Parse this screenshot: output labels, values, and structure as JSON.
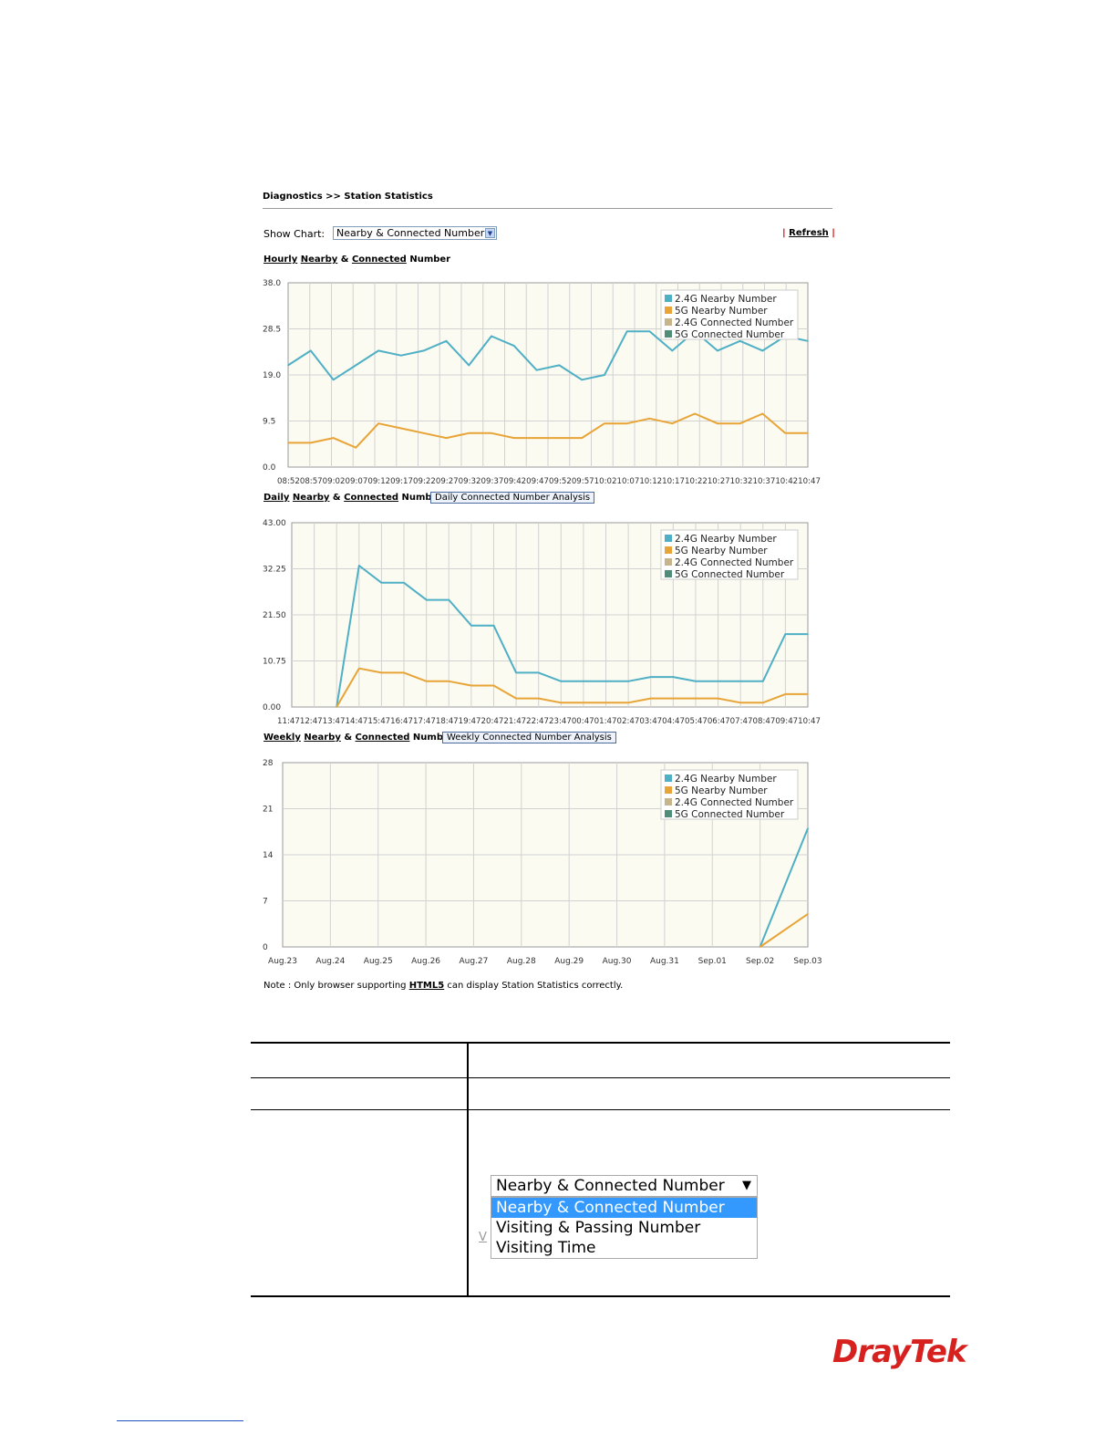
{
  "breadcrumb": "Diagnostics >> Station Statistics",
  "show_chart": {
    "label": "Show Chart:",
    "selected": "Nearby & Connected Number"
  },
  "refresh": {
    "bar_left": "|",
    "label": "Refresh",
    "bar_right": "|"
  },
  "sections": {
    "hourly": {
      "w1": "Hourly",
      "w2": "Nearby",
      "w3": "&",
      "w4": "Connected",
      "w5": "Number"
    },
    "daily": {
      "w1": "Daily",
      "w2": "Nearby",
      "w3": "&",
      "w4": "Connected",
      "w5": "Number",
      "button": "Daily Connected Number Analysis"
    },
    "weekly": {
      "w1": "Weekly",
      "w2": "Nearby",
      "w3": "&",
      "w4": "Connected",
      "w5": "Number",
      "button": "Weekly Connected Number Analysis"
    }
  },
  "legend": [
    "2.4G Nearby Number",
    "5G Nearby Number",
    "2.4G Connected Number",
    "5G Connected Number"
  ],
  "colors": {
    "nearby24": "#4eafc5",
    "nearby5": "#e8a436",
    "connected24": "#c8b48a",
    "connected5": "#4f8d78",
    "plot_bg": "#fbfbf2",
    "grid": "#d2d2d2"
  },
  "chart_data": [
    {
      "type": "line",
      "title": "Hourly Nearby & Connected Number",
      "x_tick_text": "08:5208:5709:0209:0709:1209:1709:2209:2709:3209:3709:4209:4709:5209:5710:0210:0710:1210:1710:2210:2710:3210:3710:4210:47",
      "ylim": [
        0,
        38
      ],
      "yticks": [
        "38.0",
        "28.5",
        "19.0",
        "9.5",
        "0.0"
      ],
      "x_count": 24,
      "series": [
        {
          "name": "2.4G Nearby Number",
          "values": [
            21,
            24,
            18,
            21,
            24,
            23,
            24,
            26,
            21,
            27,
            25,
            20,
            21,
            18,
            19,
            28,
            28,
            24,
            28,
            24,
            26,
            24,
            27,
            26
          ]
        },
        {
          "name": "5G Nearby Number",
          "values": [
            5,
            5,
            6,
            4,
            9,
            8,
            7,
            6,
            7,
            7,
            6,
            6,
            6,
            6,
            9,
            9,
            10,
            9,
            11,
            9,
            9,
            11,
            7,
            7
          ]
        },
        {
          "name": "2.4G Connected Number",
          "values": []
        },
        {
          "name": "5G Connected Number",
          "values": []
        }
      ]
    },
    {
      "type": "line",
      "title": "Daily Nearby & Connected Number",
      "x_tick_text": "11:4712:4713:4714:4715:4716:4717:4718:4719:4720:4721:4722:4723:4700:4701:4702:4703:4704:4705:4706:4707:4708:4709:4710:47",
      "ylim": [
        0,
        43
      ],
      "yticks": [
        "43.00",
        "32.25",
        "21.50",
        "10.75",
        "0.00"
      ],
      "x_count": 23,
      "series": [
        {
          "name": "2.4G Nearby Number",
          "values": [
            null,
            null,
            0,
            33,
            29,
            29,
            25,
            25,
            19,
            19,
            8,
            8,
            6,
            6,
            6,
            6,
            7,
            7,
            6,
            6,
            6,
            6,
            17,
            17
          ]
        },
        {
          "name": "5G Nearby Number",
          "values": [
            null,
            null,
            0,
            9,
            8,
            8,
            6,
            6,
            5,
            5,
            2,
            2,
            1,
            1,
            1,
            1,
            2,
            2,
            2,
            2,
            1,
            1,
            3,
            3
          ]
        },
        {
          "name": "2.4G Connected Number",
          "values": []
        },
        {
          "name": "5G Connected Number",
          "values": []
        }
      ]
    },
    {
      "type": "line",
      "title": "Weekly Nearby & Connected Number",
      "categories": [
        "Aug.23",
        "Aug.24",
        "Aug.25",
        "Aug.26",
        "Aug.27",
        "Aug.28",
        "Aug.29",
        "Aug.30",
        "Aug.31",
        "Sep.01",
        "Sep.02",
        "Sep.03"
      ],
      "ylim": [
        0,
        28
      ],
      "yticks": [
        "28",
        "21",
        "14",
        "7",
        "0"
      ],
      "series": [
        {
          "name": "2.4G Nearby Number",
          "values": [
            null,
            null,
            null,
            null,
            null,
            null,
            null,
            null,
            null,
            null,
            0,
            18
          ]
        },
        {
          "name": "5G Nearby Number",
          "values": [
            null,
            null,
            null,
            null,
            null,
            null,
            null,
            null,
            null,
            null,
            0,
            5
          ]
        },
        {
          "name": "2.4G Connected Number",
          "values": []
        },
        {
          "name": "5G Connected Number",
          "values": []
        }
      ]
    }
  ],
  "note": {
    "before": "Note : Only browser supporting ",
    "link": "HTML5",
    "after": " can display Station Statistics correctly."
  },
  "dropdown_options": [
    "Nearby & Connected Number",
    "Visiting & Passing Number",
    "Visiting Time"
  ],
  "dropdown_selected": "Nearby & Connected Number",
  "stray_char": "V",
  "logo": "DrayTek"
}
